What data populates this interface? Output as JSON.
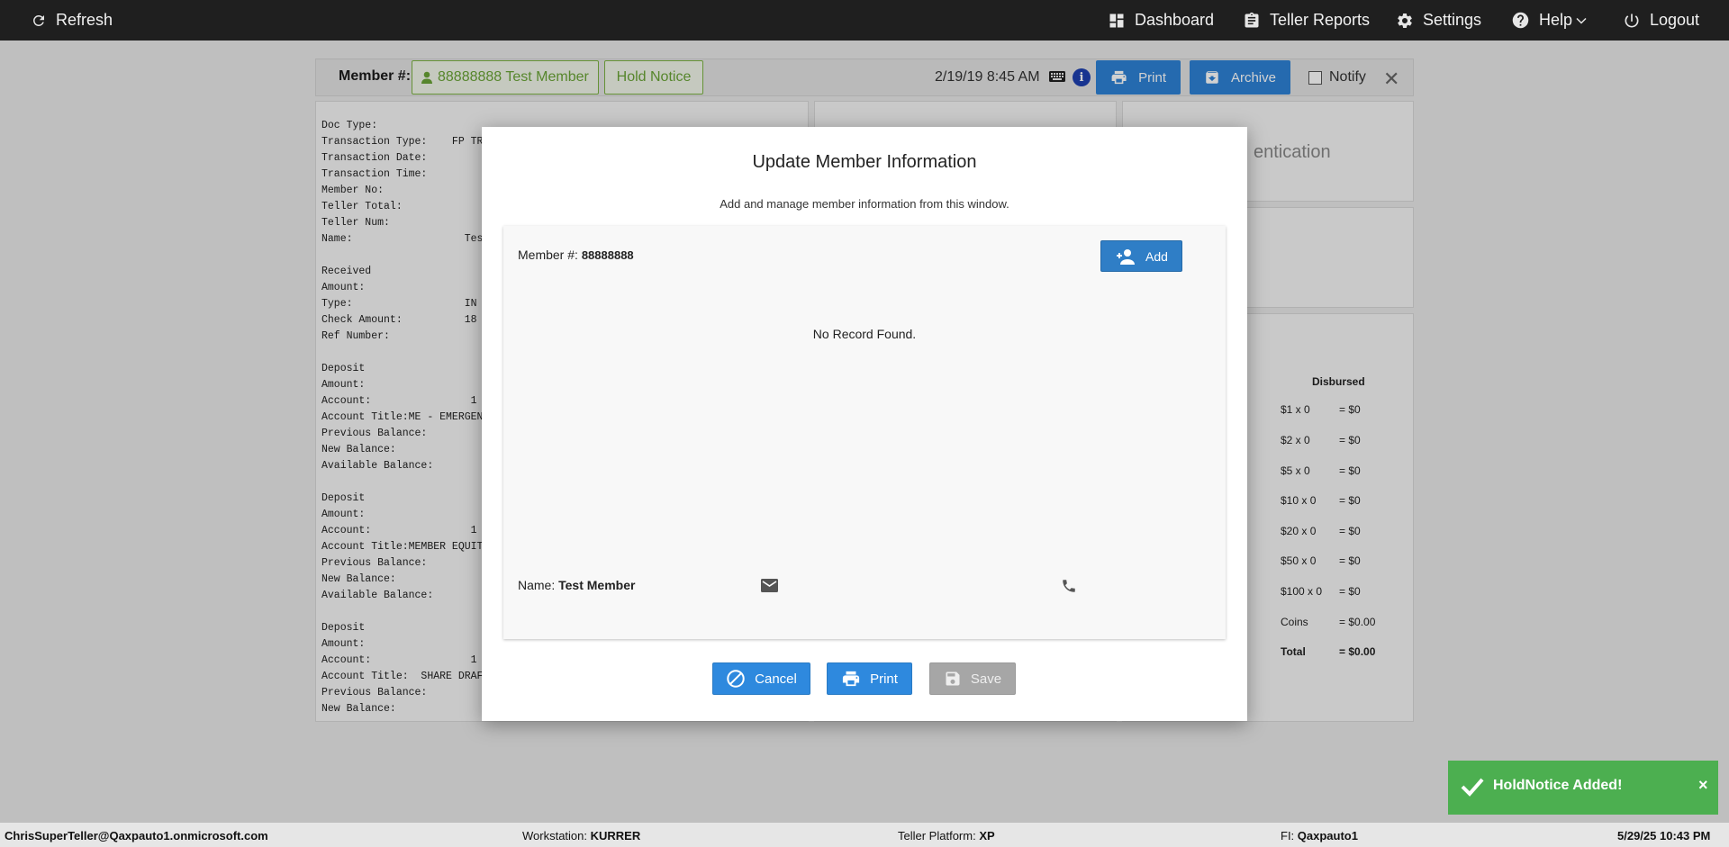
{
  "nav": {
    "refresh": "Refresh",
    "dashboard": "Dashboard",
    "teller_reports": "Teller Reports",
    "settings": "Settings",
    "help": "Help",
    "logout": "Logout"
  },
  "toolbar": {
    "member_label": "Member #:",
    "member_button": "88888888 Test Member",
    "hold_notice": "Hold Notice",
    "datetime": "2/19/19 8:45 AM",
    "print": "Print",
    "archive": "Archive",
    "notify": "Notify"
  },
  "receipt_lines": [
    "Doc Type:",
    "Transaction Type:    FP TRA",
    "Transaction Date:",
    "Transaction Time:",
    "Member No:",
    "Teller Total:",
    "Teller Num:",
    "Name:                  Tes",
    "",
    "Received",
    "Amount:",
    "Type:                  IN",
    "Check Amount:          18",
    "Ref Number:",
    "",
    "Deposit",
    "Amount:",
    "Account:                1",
    "Account Title:ME - EMERGENC",
    "Previous Balance:",
    "New Balance:",
    "Available Balance:",
    "",
    "Deposit",
    "Amount:",
    "Account:                1",
    "Account Title:MEMBER EQUITY",
    "Previous Balance:",
    "New Balance:",
    "Available Balance:",
    "",
    "Deposit",
    "Amount:",
    "Account:                1",
    "Account Title:  SHARE DRAFT",
    "Previous Balance:",
    "New Balance:"
  ],
  "auth_partial": "entication",
  "disbursed": {
    "header": "Disbursed",
    "rows": [
      {
        "label": "$1 x 0",
        "value": "= $0"
      },
      {
        "label": "$2 x 0",
        "value": "= $0"
      },
      {
        "label": "$5 x 0",
        "value": "= $0"
      },
      {
        "label": "$10 x 0",
        "value": "= $0"
      },
      {
        "label": "$20 x 0",
        "value": "= $0"
      },
      {
        "label": "$50 x 0",
        "value": "= $0"
      },
      {
        "label": "$100 x 0",
        "value": "= $0"
      },
      {
        "label": "Coins",
        "value": "= $0.00"
      },
      {
        "label": "Total",
        "value": "= $0.00"
      }
    ]
  },
  "modal": {
    "title": "Update Member Information",
    "subtitle": "Add and manage member information from this window.",
    "member_label": "Member #: ",
    "member_number": "88888888",
    "add": "Add",
    "no_record": "No Record Found.",
    "name_label": "Name: ",
    "name_value": "Test Member",
    "cancel": "Cancel",
    "print": "Print",
    "save": "Save"
  },
  "toast": {
    "message": "HoldNotice Added!",
    "close": "×",
    "color": "#4caf50"
  },
  "statusbar": {
    "user": "ChrisSuperTeller@Qaxpauto1.onmicrosoft.com",
    "workstation_label": "Workstation: ",
    "workstation": "KURRER",
    "platform_label": "Teller Platform: ",
    "platform": "XP",
    "fi_label": "FI: ",
    "fi": "Qaxpauto1",
    "datetime": "5/29/25 10:43 PM"
  }
}
